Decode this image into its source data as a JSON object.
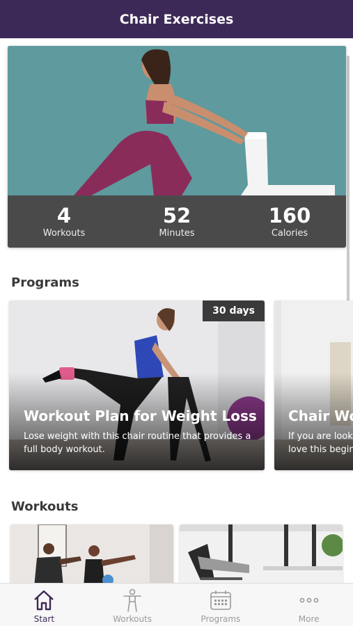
{
  "header": {
    "title": "Chair Exercises"
  },
  "colors": {
    "brand": "#3d2957",
    "stats_bg": "#4a4a4a",
    "hero_bg": "#5e9a9e",
    "tab_inactive": "#9a9a9a"
  },
  "hero": {
    "stats": [
      {
        "value": "4",
        "label": "Workouts"
      },
      {
        "value": "52",
        "label": "Minutes"
      },
      {
        "value": "160",
        "label": "Calories"
      }
    ]
  },
  "programs": {
    "title": "Programs",
    "items": [
      {
        "badge": "30 days",
        "title": "Workout Plan for Weight Loss",
        "description": "Lose weight with this chair routine that provides a full body workout."
      },
      {
        "title": "Chair Wo",
        "description": "If you are look love this begin"
      }
    ]
  },
  "workouts": {
    "title": "Workouts"
  },
  "tabs": [
    {
      "label": "Start",
      "icon": "home-icon"
    },
    {
      "label": "Workouts",
      "icon": "person-icon"
    },
    {
      "label": "Programs",
      "icon": "calendar-icon"
    },
    {
      "label": "More",
      "icon": "more-icon"
    }
  ]
}
